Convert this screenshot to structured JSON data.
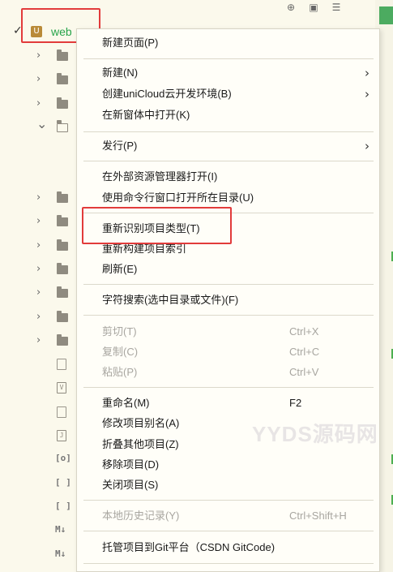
{
  "tree": {
    "project_name": "web",
    "project_icon_letter": "U",
    "check_mark": "✓",
    "toolbar_icons": [
      "target-icon",
      "collapse-icon",
      "menu-icon"
    ],
    "rows": [
      {
        "kind": "folder",
        "expanded": false
      },
      {
        "kind": "folder",
        "expanded": false
      },
      {
        "kind": "folder",
        "expanded": false
      },
      {
        "kind": "folder",
        "expanded": true
      },
      {
        "kind": "folder",
        "expanded": false
      },
      {
        "kind": "folder",
        "expanded": false
      },
      {
        "kind": "folder",
        "expanded": false
      },
      {
        "kind": "folder",
        "expanded": false
      },
      {
        "kind": "folder",
        "expanded": false
      },
      {
        "kind": "folder",
        "expanded": false
      },
      {
        "kind": "folder",
        "expanded": false
      },
      {
        "kind": "file",
        "badge": ""
      },
      {
        "kind": "file",
        "badge": "V"
      },
      {
        "kind": "file",
        "badge": ""
      },
      {
        "kind": "file",
        "badge": "J"
      },
      {
        "kind": "file",
        "badge": "[o]"
      },
      {
        "kind": "file",
        "badge": "[ ]"
      },
      {
        "kind": "file",
        "badge": "[ ]"
      },
      {
        "kind": "file",
        "badge": "M↓"
      },
      {
        "kind": "file",
        "badge": "M↓"
      }
    ]
  },
  "menu": {
    "new_page": "新建页面(P)",
    "new": "新建(N)",
    "create_unicloud": "创建uniCloud云开发环境(B)",
    "open_new_window": "在新窗体中打开(K)",
    "publish": "发行(P)",
    "open_in_explorer": "在外部资源管理器打开(I)",
    "open_in_terminal": "使用命令行窗口打开所在目录(U)",
    "reidentify_type": "重新识别项目类型(T)",
    "rebuild_index": "重新构建项目索引",
    "refresh": "刷新(E)",
    "search_text": "字符搜索(选中目录或文件)(F)",
    "cut": "剪切(T)",
    "cut_shortcut": "Ctrl+X",
    "copy": "复制(C)",
    "copy_shortcut": "Ctrl+C",
    "paste": "粘贴(P)",
    "paste_shortcut": "Ctrl+V",
    "rename": "重命名(M)",
    "rename_shortcut": "F2",
    "edit_alias": "修改项目别名(A)",
    "collapse_others": "折叠其他项目(Z)",
    "remove_project": "移除项目(D)",
    "close_project": "关闭项目(S)",
    "local_history": "本地历史记录(Y)",
    "local_history_shortcut": "Ctrl+Shift+H",
    "host_on_git": "托管项目到Git平台（CSDN GitCode)"
  },
  "watermark": "YYDS源码网",
  "colors": {
    "highlight_box": "#e23b3b",
    "project_name": "#27a44b",
    "disabled_text": "#a8a6a0",
    "background": "#fbf9ec"
  }
}
